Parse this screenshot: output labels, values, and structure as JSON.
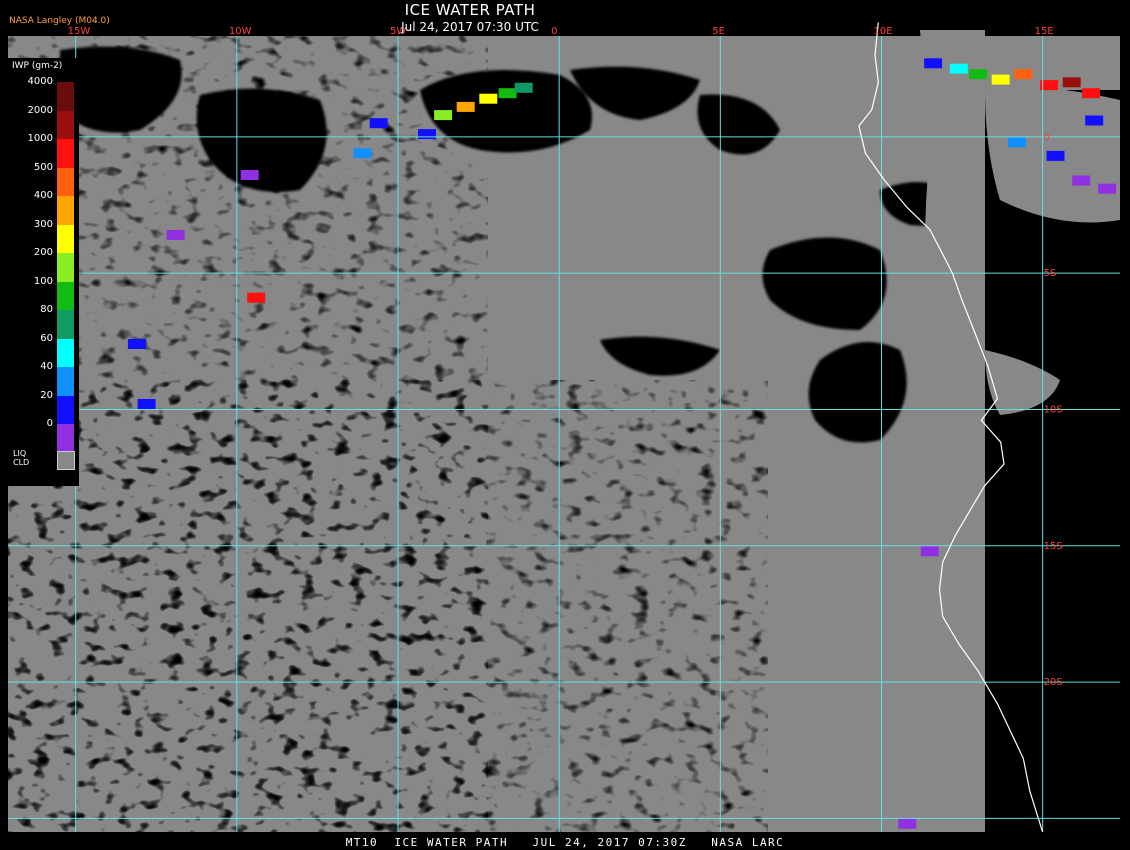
{
  "title": "ICE WATER PATH",
  "subtitle": "Jul 24, 2017 07:30 UTC",
  "credit": "NASA Langley (M04.0)",
  "footer": "MT10  ICE WATER PATH   JUL 24, 2017 07:30Z   NASA LARC",
  "colors": {
    "background": "#000000",
    "liquid_cloud": "#888888",
    "grid": "#66e0e0",
    "grid_label": "#ff4040",
    "coastline": "#ffffff",
    "credit": "#ffa040"
  },
  "legend": {
    "title": "IWP (gm-2)",
    "levels": [
      {
        "label": "4000",
        "color": "#6b0c0c"
      },
      {
        "label": "2000",
        "color": "#9b0f0f"
      },
      {
        "label": "1000",
        "color": "#ff1010"
      },
      {
        "label": "500",
        "color": "#ff6010"
      },
      {
        "label": "400",
        "color": "#ffa500"
      },
      {
        "label": "300",
        "color": "#ffff00"
      },
      {
        "label": "200",
        "color": "#88ee22"
      },
      {
        "label": "100",
        "color": "#11bb11"
      },
      {
        "label": "80",
        "color": "#119966"
      },
      {
        "label": "60",
        "color": "#00ffff"
      },
      {
        "label": "40",
        "color": "#1090ff"
      },
      {
        "label": "20",
        "color": "#1010ff"
      },
      {
        "label": "0",
        "color": "#9030e0"
      }
    ],
    "liquid_label_line1": "LIQ",
    "liquid_label_line2": "CLD"
  },
  "map": {
    "lon_range": [
      -17.1,
      17.4
    ],
    "lat_range": [
      -25.5,
      3.7
    ],
    "meridians": [
      {
        "lon": -15,
        "label": "15W"
      },
      {
        "lon": -10,
        "label": "10W"
      },
      {
        "lon": -5,
        "label": "5W"
      },
      {
        "lon": 0,
        "label": "0"
      },
      {
        "lon": 5,
        "label": "5E"
      },
      {
        "lon": 10,
        "label": "10E"
      },
      {
        "lon": 15,
        "label": "15E"
      }
    ],
    "parallels": [
      {
        "lat": 0,
        "label": "0"
      },
      {
        "lat": -5,
        "label": "5S"
      },
      {
        "lat": -10,
        "label": "10S"
      },
      {
        "lat": -15,
        "label": "15S"
      },
      {
        "lat": -20,
        "label": "20S"
      },
      {
        "lat": -25,
        "label": ""
      }
    ],
    "coastline": [
      [
        9.9,
        4.2
      ],
      [
        9.8,
        3.0
      ],
      [
        9.9,
        2.0
      ],
      [
        9.7,
        1.0
      ],
      [
        9.3,
        0.4
      ],
      [
        9.5,
        -0.6
      ],
      [
        10.1,
        -1.6
      ],
      [
        10.8,
        -2.6
      ],
      [
        11.5,
        -3.4
      ],
      [
        11.9,
        -4.3
      ],
      [
        12.2,
        -5.0
      ],
      [
        12.5,
        -6.0
      ],
      [
        12.9,
        -7.2
      ],
      [
        13.3,
        -8.4
      ],
      [
        13.6,
        -9.6
      ],
      [
        13.1,
        -10.4
      ],
      [
        13.7,
        -11.2
      ],
      [
        13.8,
        -12.0
      ],
      [
        13.2,
        -12.8
      ],
      [
        12.8,
        -13.6
      ],
      [
        12.3,
        -14.6
      ],
      [
        11.9,
        -15.6
      ],
      [
        11.8,
        -16.6
      ],
      [
        11.9,
        -17.6
      ],
      [
        12.4,
        -18.6
      ],
      [
        13.0,
        -19.6
      ],
      [
        13.6,
        -20.8
      ],
      [
        14.0,
        -21.8
      ],
      [
        14.4,
        -22.8
      ],
      [
        14.6,
        -24.0
      ],
      [
        15.0,
        -25.5
      ]
    ],
    "ice_clusters": [
      {
        "lon": -3.6,
        "lat": 0.8,
        "iwp": 200
      },
      {
        "lon": -2.9,
        "lat": 1.1,
        "iwp": 400
      },
      {
        "lon": -2.2,
        "lat": 1.4,
        "iwp": 300
      },
      {
        "lon": -1.6,
        "lat": 1.6,
        "iwp": 100
      },
      {
        "lon": -1.1,
        "lat": 1.8,
        "iwp": 80
      },
      {
        "lon": -4.1,
        "lat": 0.1,
        "iwp": 20
      },
      {
        "lon": -5.6,
        "lat": 0.5,
        "iwp": 20
      },
      {
        "lon": -6.1,
        "lat": -0.6,
        "iwp": 40
      },
      {
        "lon": -9.6,
        "lat": -1.4,
        "iwp": 0
      },
      {
        "lon": -11.9,
        "lat": -3.6,
        "iwp": 0
      },
      {
        "lon": -13.1,
        "lat": -7.6,
        "iwp": 20
      },
      {
        "lon": -12.8,
        "lat": -9.8,
        "iwp": 20
      },
      {
        "lon": -9.4,
        "lat": -5.9,
        "iwp": 1000
      },
      {
        "lon": 11.6,
        "lat": 2.7,
        "iwp": 20
      },
      {
        "lon": 12.4,
        "lat": 2.5,
        "iwp": 60
      },
      {
        "lon": 13.0,
        "lat": 2.3,
        "iwp": 100
      },
      {
        "lon": 13.7,
        "lat": 2.1,
        "iwp": 300
      },
      {
        "lon": 14.4,
        "lat": 2.3,
        "iwp": 500
      },
      {
        "lon": 15.2,
        "lat": 1.9,
        "iwp": 1000
      },
      {
        "lon": 15.9,
        "lat": 2.0,
        "iwp": 2000
      },
      {
        "lon": 16.5,
        "lat": 1.6,
        "iwp": 1000
      },
      {
        "lon": 16.6,
        "lat": 0.6,
        "iwp": 20
      },
      {
        "lon": 14.2,
        "lat": -0.2,
        "iwp": 40
      },
      {
        "lon": 15.4,
        "lat": -0.7,
        "iwp": 20
      },
      {
        "lon": 16.2,
        "lat": -1.6,
        "iwp": 0
      },
      {
        "lon": 17.0,
        "lat": -1.9,
        "iwp": 0
      },
      {
        "lon": 11.5,
        "lat": -15.2,
        "iwp": 0
      },
      {
        "lon": 10.8,
        "lat": -25.2,
        "iwp": 0
      }
    ]
  }
}
